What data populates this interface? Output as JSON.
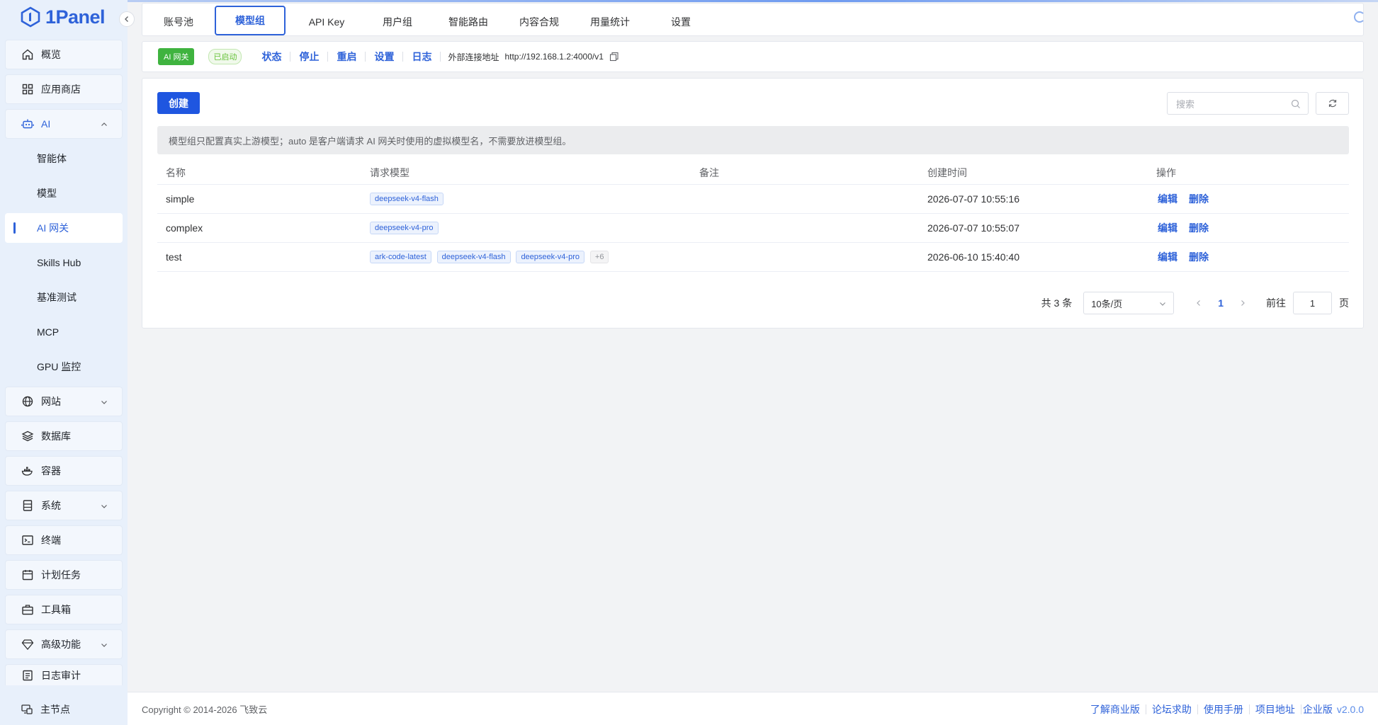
{
  "app": {
    "logo_text": "1Panel"
  },
  "sidebar": {
    "items": [
      {
        "label": "概览",
        "icon": "home-icon"
      },
      {
        "label": "应用商店",
        "icon": "grid-icon"
      },
      {
        "label": "AI",
        "icon": "robot-icon"
      },
      {
        "label": "智能体"
      },
      {
        "label": "模型"
      },
      {
        "label": "AI 网关"
      },
      {
        "label": "Skills Hub"
      },
      {
        "label": "基准测试"
      },
      {
        "label": "MCP"
      },
      {
        "label": "GPU 监控"
      },
      {
        "label": "网站",
        "icon": "globe-icon"
      },
      {
        "label": "数据库",
        "icon": "layers-icon"
      },
      {
        "label": "容器",
        "icon": "docker-icon"
      },
      {
        "label": "系统",
        "icon": "server-icon"
      },
      {
        "label": "终端",
        "icon": "terminal-icon"
      },
      {
        "label": "计划任务",
        "icon": "calendar-icon"
      },
      {
        "label": "工具箱",
        "icon": "toolbox-icon"
      },
      {
        "label": "高级功能",
        "icon": "diamond-icon"
      },
      {
        "label": "日志审计",
        "icon": "log-icon"
      },
      {
        "label": "主节点",
        "icon": "node-icon"
      }
    ]
  },
  "tabs": [
    {
      "label": "账号池"
    },
    {
      "label": "模型组"
    },
    {
      "label": "API Key"
    },
    {
      "label": "用户组"
    },
    {
      "label": "智能路由"
    },
    {
      "label": "内容合规"
    },
    {
      "label": "用量统计"
    },
    {
      "label": "设置"
    }
  ],
  "status_bar": {
    "app_tag": "AI 网关",
    "state": "已启动",
    "actions": [
      "状态",
      "停止",
      "重启",
      "设置",
      "日志"
    ],
    "ext_label": "外部连接地址",
    "ext_url": "http://192.168.1.2:4000/v1"
  },
  "main": {
    "create_label": "创建",
    "search_placeholder": "搜索",
    "notice": "模型组只配置真实上游模型；auto 是客户端请求 AI 网关时使用的虚拟模型名，不需要放进模型组。",
    "columns": [
      "名称",
      "请求模型",
      "备注",
      "创建时间",
      "操作"
    ],
    "rows": [
      {
        "name": "simple",
        "models": [
          "deepseek-v4-flash"
        ],
        "remark": "",
        "created": "2026-07-07 10:55:16",
        "edit": "编辑",
        "delete": "删除"
      },
      {
        "name": "complex",
        "models": [
          "deepseek-v4-pro"
        ],
        "remark": "",
        "created": "2026-07-07 10:55:07",
        "edit": "编辑",
        "delete": "删除"
      },
      {
        "name": "test",
        "models": [
          "ark-code-latest",
          "deepseek-v4-flash",
          "deepseek-v4-pro"
        ],
        "more": "+6",
        "remark": "",
        "created": "2026-06-10 15:40:40",
        "edit": "编辑",
        "delete": "删除"
      }
    ],
    "pagination": {
      "total": "共 3 条",
      "page_size": "10条/页",
      "current_page": "1",
      "goto_label": "前往",
      "goto_value": "1",
      "page_suffix": "页"
    }
  },
  "footer": {
    "copyright": "Copyright © 2014-2026 飞致云",
    "links": [
      "了解商业版",
      "论坛求助",
      "使用手册",
      "项目地址"
    ],
    "edition": "企业版",
    "version": "v2.0.0"
  },
  "colors": {
    "accent": "#2e62d9",
    "success": "#3fb33f",
    "sidebar_bg": "#e8f0fb"
  }
}
